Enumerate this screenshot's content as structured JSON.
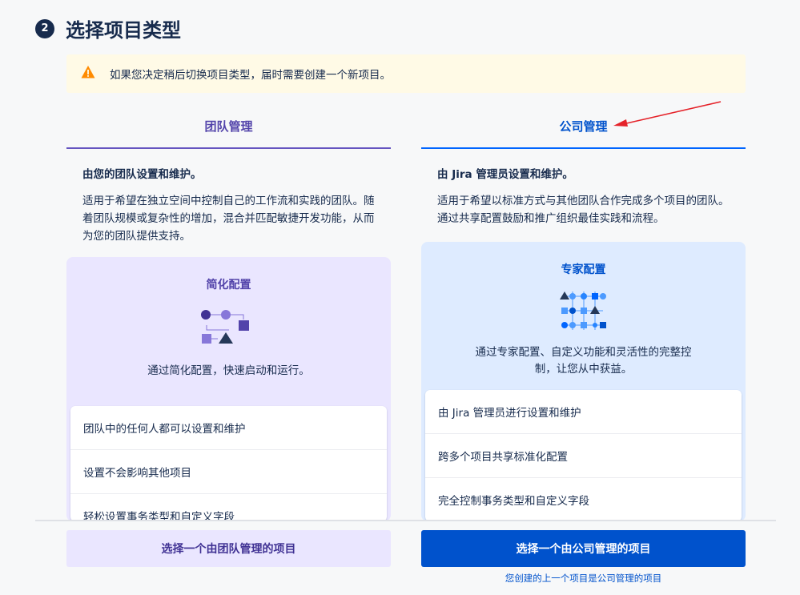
{
  "step": {
    "number": "2",
    "title": "选择项目类型"
  },
  "warning": {
    "icon": "warning-icon",
    "text": "如果您决定稍后切换项目类型，届时需要创建一个新项目。",
    "color": "#ff8b00"
  },
  "team": {
    "tab": "团队管理",
    "owner": "由您的团队设置和维护。",
    "desc": "适用于希望在独立空间中控制自己的工作流和实践的团队。随着团队规模或复杂性的增加，混合并匹配敏捷开发功能，从而为您的团队提供支持。",
    "card_title": "简化配置",
    "card_desc": "通过简化配置，快速启动和运行。",
    "features": [
      "团队中的任何人都可以设置和维护",
      "设置不会影响其他项目",
      "轻松设置事务类型和自定义字段"
    ],
    "button": "选择一个由团队管理的项目",
    "accent": "#6554c0"
  },
  "company": {
    "tab": "公司管理",
    "owner": "由 Jira 管理员设置和维护。",
    "desc": "适用于希望以标准方式与其他团队合作完成多个项目的团队。通过共享配置鼓励和推广组织最佳实践和流程。",
    "card_title": "专家配置",
    "card_desc": "通过专家配置、自定义功能和灵活性的完整控制，让您从中获益。",
    "features": [
      "由 Jira 管理员进行设置和维护",
      "跨多个项目共享标准化配置",
      "完全控制事务类型和自定义字段"
    ],
    "button": "选择一个由公司管理的项目",
    "hint": "您创建的上一个项目是公司管理的项目",
    "accent": "#0052cc"
  }
}
